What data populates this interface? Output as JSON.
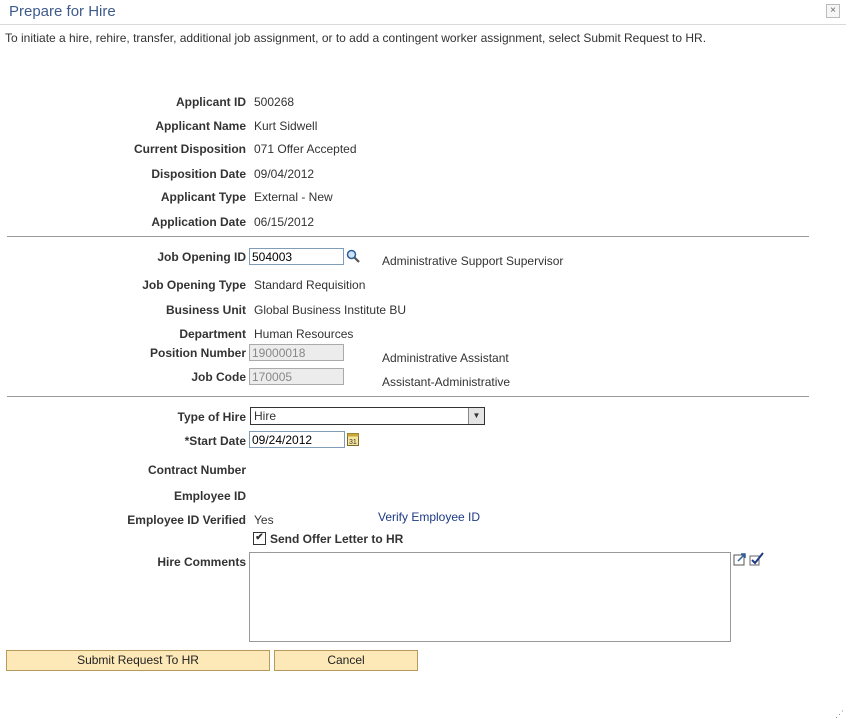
{
  "page": {
    "title": "Prepare for Hire",
    "close_label": "×",
    "intro": "To initiate a hire, rehire, transfer, additional job assignment, or to add a contingent worker assignment, select Submit Request to HR."
  },
  "applicant": {
    "id_label": "Applicant ID",
    "id": "500268",
    "name_label": "Applicant Name",
    "name": "Kurt Sidwell",
    "disposition_label": "Current Disposition",
    "disposition": "071 Offer Accepted",
    "disposition_date_label": "Disposition Date",
    "disposition_date": "09/04/2012",
    "type_label": "Applicant Type",
    "type": "External - New",
    "application_date_label": "Application Date",
    "application_date": "06/15/2012"
  },
  "job": {
    "opening_id_label": "Job Opening ID",
    "opening_id": "504003",
    "opening_desc": "Administrative Support Supervisor",
    "opening_type_label": "Job Opening Type",
    "opening_type": "Standard Requisition",
    "business_unit_label": "Business Unit",
    "business_unit": "Global Business Institute BU",
    "department_label": "Department",
    "department": "Human Resources",
    "position_number_label": "Position Number",
    "position_number": "19000018",
    "position_desc": "Administrative Assistant",
    "job_code_label": "Job Code",
    "job_code": "170005",
    "job_code_desc": "Assistant-Administrative"
  },
  "hire": {
    "type_label": "Type of Hire",
    "type": "Hire",
    "start_date_label": "*Start Date",
    "start_date": "09/24/2012",
    "contract_label": "Contract Number",
    "employee_id_label": "Employee ID",
    "verified_label": "Employee ID Verified",
    "verified": "Yes",
    "verify_link": "Verify Employee ID",
    "send_offer_label": "Send Offer Letter to HR",
    "send_offer_checked": "✔",
    "comments_label": "Hire Comments"
  },
  "buttons": {
    "submit": "Submit Request To HR",
    "cancel": "Cancel"
  },
  "colors": {
    "title": "#3f5b8c",
    "link": "#1d3b86",
    "button_bg": "#fde9b8"
  }
}
